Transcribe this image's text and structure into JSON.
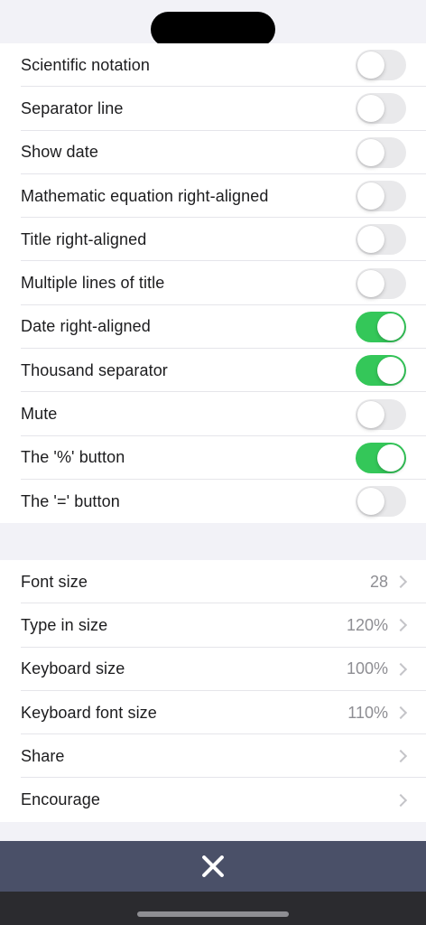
{
  "toggle_settings": [
    {
      "label": "Scientific notation",
      "on": false
    },
    {
      "label": "Separator line",
      "on": false
    },
    {
      "label": "Show date",
      "on": false
    },
    {
      "label": "Mathematic equation right-aligned",
      "on": false
    },
    {
      "label": "Title right-aligned",
      "on": false
    },
    {
      "label": "Multiple lines of title",
      "on": false
    },
    {
      "label": "Date right-aligned",
      "on": true
    },
    {
      "label": "Thousand separator",
      "on": true
    },
    {
      "label": "Mute",
      "on": false
    },
    {
      "label": "The '%' button",
      "on": true
    },
    {
      "label": "The '=' button",
      "on": false
    }
  ],
  "nav_settings": [
    {
      "label": "Font size",
      "value": "28"
    },
    {
      "label": "Type in size",
      "value": "120%"
    },
    {
      "label": "Keyboard size",
      "value": "100%"
    },
    {
      "label": "Keyboard font size",
      "value": "110%"
    },
    {
      "label": "Share",
      "value": ""
    },
    {
      "label": "Encourage",
      "value": ""
    }
  ],
  "bottom_bar": {
    "close_icon": "close-icon"
  },
  "colors": {
    "toggle_on": "#34c759",
    "toggle_off": "#e9e9eb",
    "bottom_bar": "#4a5068"
  }
}
